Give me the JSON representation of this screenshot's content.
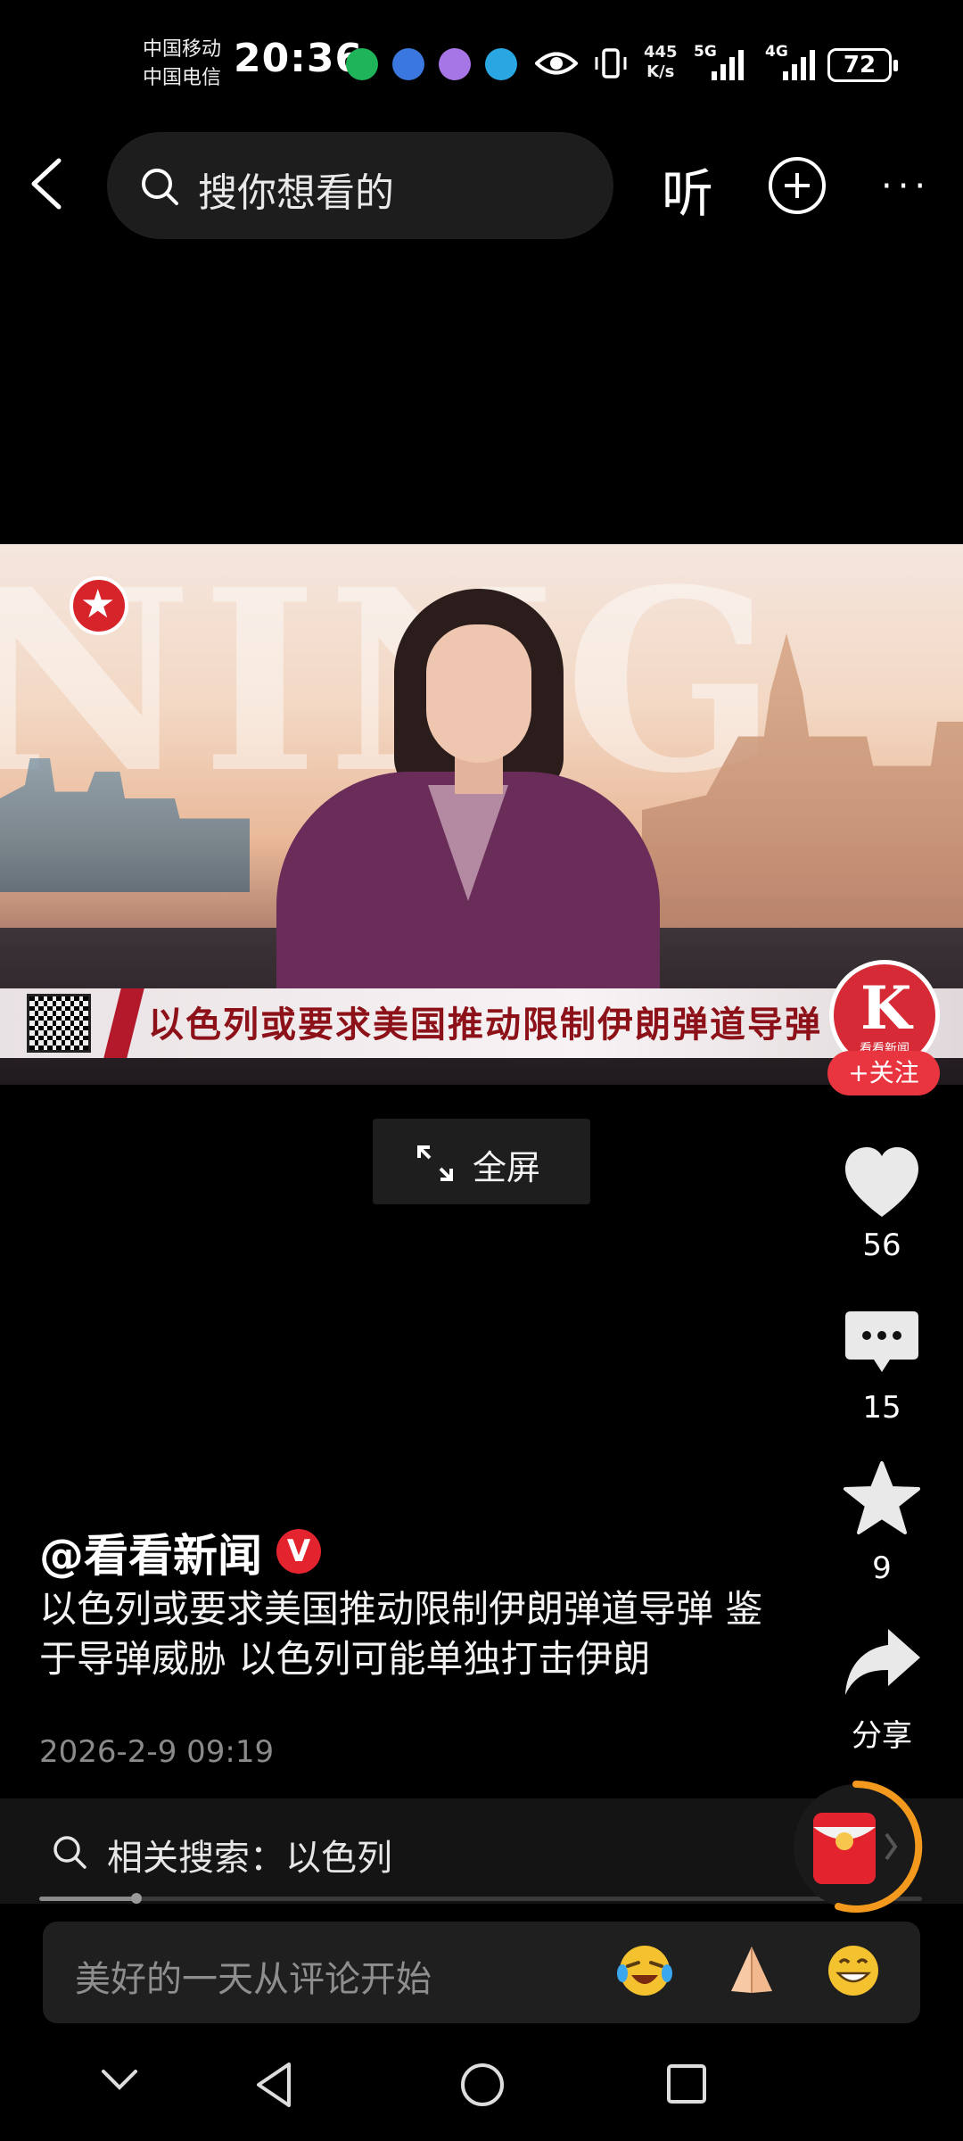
{
  "status_bar": {
    "carrier_1": "中国移动",
    "carrier_2": "中国电信",
    "time": "20:36",
    "net_speed_value": "445",
    "net_speed_unit": "K/s",
    "signal_1": "5G",
    "signal_2": "4G",
    "battery": "72"
  },
  "top_nav": {
    "search_placeholder": "搜你想看的",
    "listen_label": "听",
    "more_label": "···"
  },
  "video": {
    "headline": "以色列或要求美国推动限制伊朗弹道导弹",
    "channel_badge_name": "看看新闻",
    "follow_label": "+关注",
    "watermark": "NING"
  },
  "fullscreen_label": "全屏",
  "actions": {
    "likes": "56",
    "comments": "15",
    "favorites": "9",
    "share_label": "分享"
  },
  "post": {
    "author": "@看看新闻",
    "verified_badge": "V",
    "description": "以色列或要求美国推动限制伊朗弹道导弹 鉴于导弹威胁 以色列可能单独打击伊朗",
    "date": "2026-2-9 09:19"
  },
  "related_search": {
    "label": "相关搜索：以色列"
  },
  "progress": {
    "played_fraction": 0.11
  },
  "comment_bar": {
    "placeholder": "美好的一天从评论开始"
  },
  "colors": {
    "accent_red": "#e8353f",
    "envelope_ring": "#f39a1e"
  }
}
